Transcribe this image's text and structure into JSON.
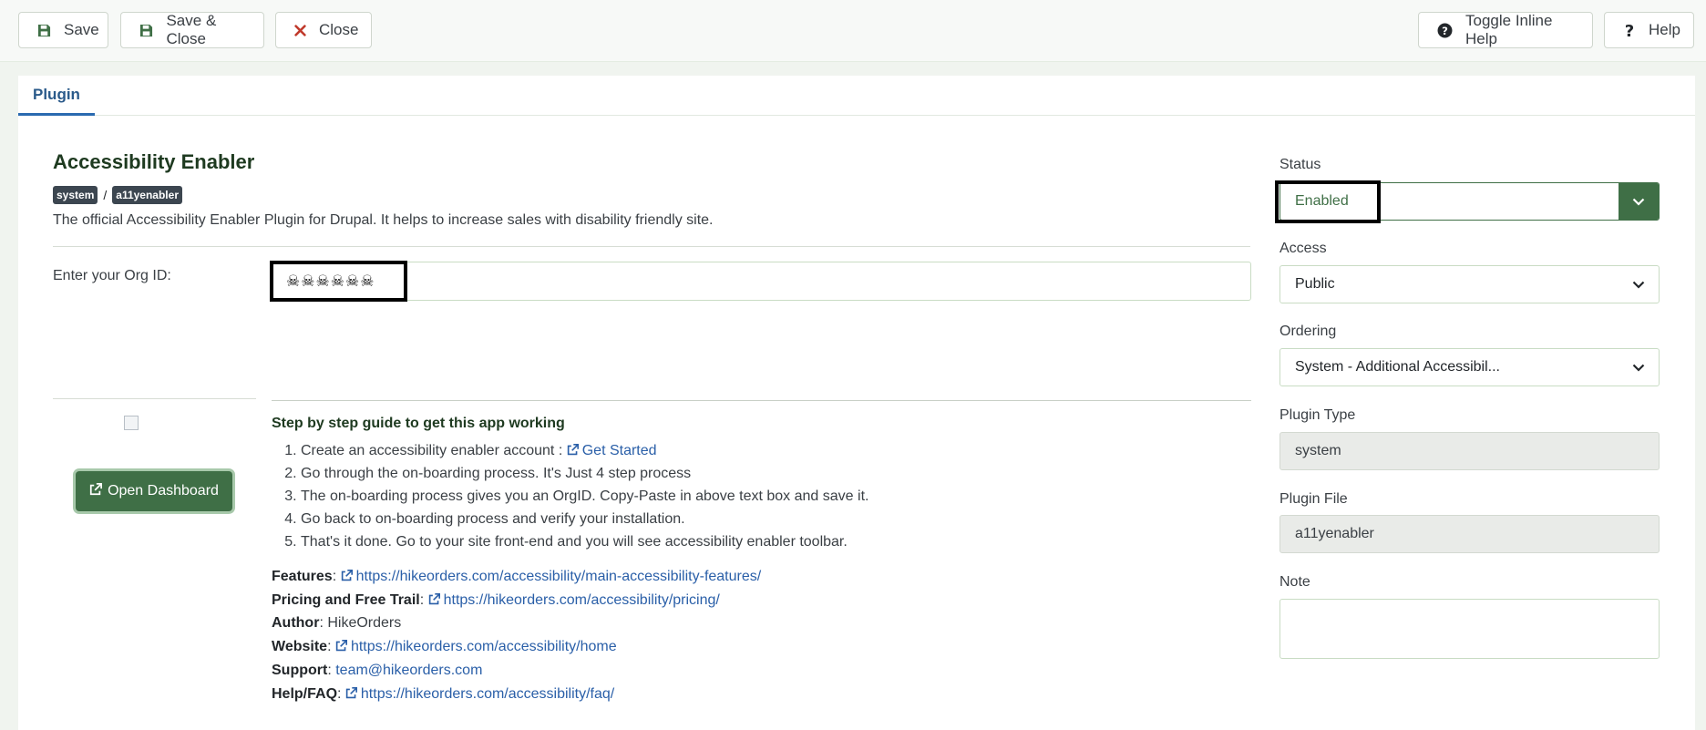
{
  "toolbar": {
    "save": "Save",
    "save_close": "Save & Close",
    "close": "Close",
    "toggle_help": "Toggle Inline Help",
    "help": "Help"
  },
  "tabs": [
    {
      "label": "Plugin",
      "active": true
    }
  ],
  "plugin": {
    "title": "Accessibility Enabler",
    "breadcrumb_group": "system",
    "breadcrumb_sep": "/",
    "breadcrumb_element": "a11yenabler",
    "description": "The official Accessibility Enabler Plugin for Drupal. It helps to increase sales with disability friendly site."
  },
  "org": {
    "label": "Enter your Org ID:",
    "masked_value": "☠☠☠☠☠☠"
  },
  "dashboard_button": "Open Dashboard",
  "guide": {
    "heading": "Step by step guide to get this app working",
    "steps": [
      "Create an accessibility enabler account : ",
      "Go through the on-boarding process. It's Just 4 step process",
      "The on-boarding process gives you an OrgID. Copy-Paste in above text box and save it.",
      "Go back to on-boarding process and verify your installation.",
      "That's it done. Go to your site front-end and you will see accessibility enabler toolbar."
    ],
    "get_started": "Get Started"
  },
  "links": {
    "features_label": "Features",
    "features_url": "https://hikeorders.com/accessibility/main-accessibility-features/",
    "pricing_label": "Pricing and Free Trail",
    "pricing_url": "https://hikeorders.com/accessibility/pricing/",
    "author_label": "Author",
    "author_value": "HikeOrders",
    "website_label": "Website",
    "website_url": "https://hikeorders.com/accessibility/home",
    "support_label": "Support",
    "support_email": "team@hikeorders.com",
    "faq_label": "Help/FAQ",
    "faq_url": "https://hikeorders.com/accessibility/faq/"
  },
  "sidebar": {
    "status_label": "Status",
    "status_value": "Enabled",
    "access_label": "Access",
    "access_value": "Public",
    "ordering_label": "Ordering",
    "ordering_value": "System - Additional Accessibil...",
    "type_label": "Plugin Type",
    "type_value": "system",
    "file_label": "Plugin File",
    "file_value": "a11yenabler",
    "note_label": "Note"
  },
  "colors": {
    "brand_green": "#3f6f46",
    "link_blue": "#2a5fa8",
    "close_red": "#c0392b"
  }
}
